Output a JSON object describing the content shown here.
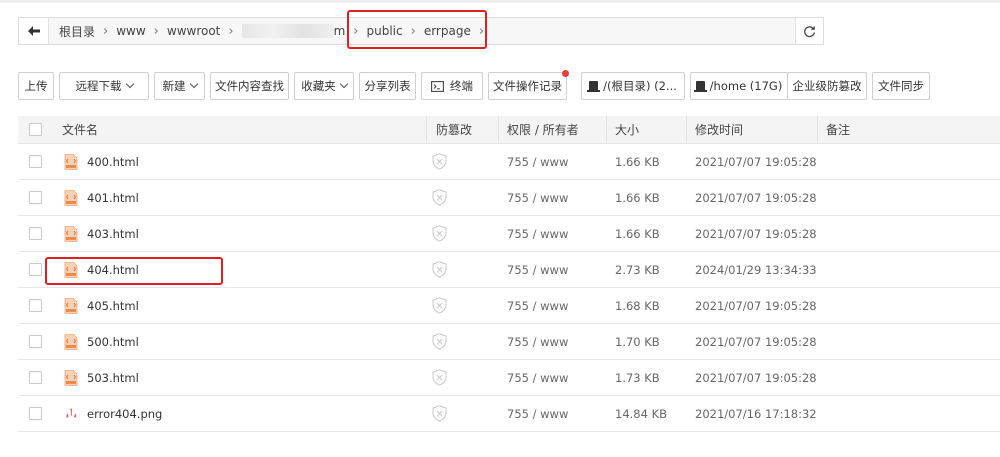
{
  "breadcrumb": {
    "items": [
      "根目录",
      "www",
      "wwwroot",
      "public",
      "errpage"
    ],
    "redacted_tail": "m"
  },
  "toolbar": {
    "upload": "上传",
    "remote_download": "远程下载",
    "new": "新建",
    "content_search": "文件内容查找",
    "favorites": "收藏夹",
    "share_list": "分享列表",
    "terminal": "终端",
    "operation_log": "文件操作记录",
    "disk_root": "/(根目录) (2...",
    "disk_home": "/home (17G)",
    "enterprise_tamper": "企业级防篡改",
    "file_sync": "文件同步"
  },
  "table": {
    "headers": {
      "name": "文件名",
      "tamper": "防篡改",
      "permission": "权限 / 所有者",
      "size": "大小",
      "mtime": "修改时间",
      "remark": "备注"
    },
    "rows": [
      {
        "name": "400.html",
        "perm": "755 / www",
        "size": "1.66 KB",
        "mtime": "2021/07/07 19:05:28",
        "icon": "html-file-icon"
      },
      {
        "name": "401.html",
        "perm": "755 / www",
        "size": "1.66 KB",
        "mtime": "2021/07/07 19:05:28",
        "icon": "html-file-icon"
      },
      {
        "name": "403.html",
        "perm": "755 / www",
        "size": "1.66 KB",
        "mtime": "2021/07/07 19:05:28",
        "icon": "html-file-icon"
      },
      {
        "name": "404.html",
        "perm": "755 / www",
        "size": "2.73 KB",
        "mtime": "2024/01/29 13:34:33",
        "icon": "html-file-icon"
      },
      {
        "name": "405.html",
        "perm": "755 / www",
        "size": "1.68 KB",
        "mtime": "2021/07/07 19:05:28",
        "icon": "html-file-icon"
      },
      {
        "name": "500.html",
        "perm": "755 / www",
        "size": "1.70 KB",
        "mtime": "2021/07/07 19:05:28",
        "icon": "html-file-icon"
      },
      {
        "name": "503.html",
        "perm": "755 / www",
        "size": "1.73 KB",
        "mtime": "2021/07/07 19:05:28",
        "icon": "html-file-icon"
      },
      {
        "name": "error404.png",
        "perm": "755 / www",
        "size": "14.84 KB",
        "mtime": "2021/07/16 17:18:32",
        "icon": "image-thumbnail-icon"
      }
    ]
  },
  "colors": {
    "highlight": "#e02020",
    "notify_dot": "#ee3a3a",
    "html_icon": "#f0a672"
  }
}
